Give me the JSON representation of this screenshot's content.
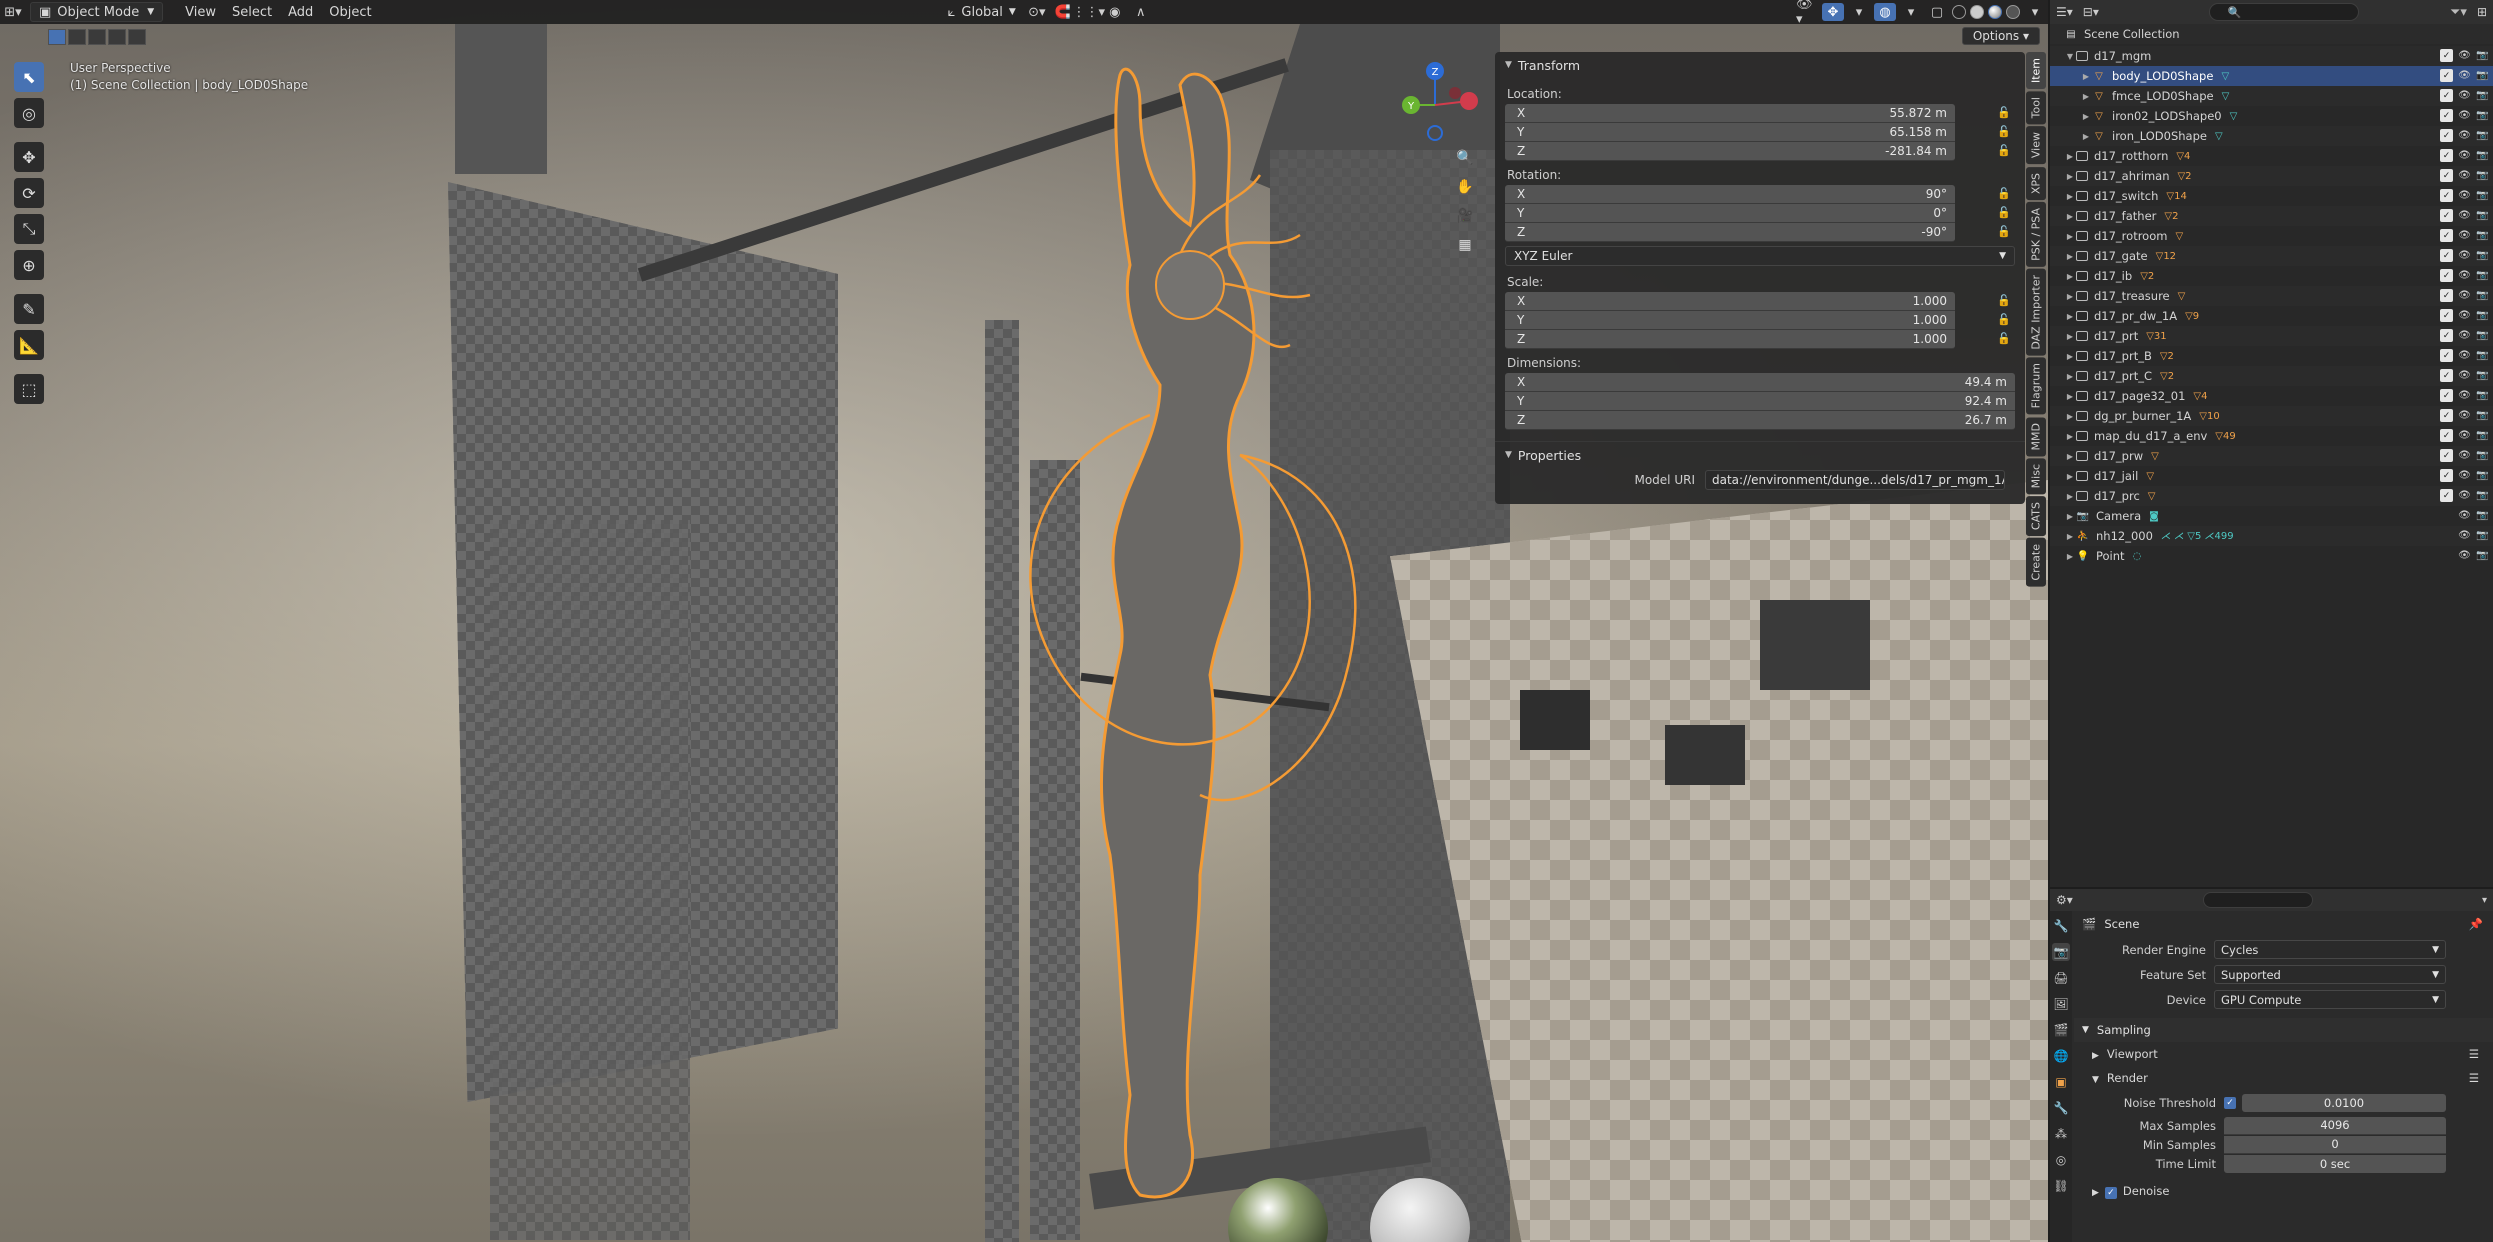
{
  "header": {
    "mode": "Object Mode",
    "menus": [
      "View",
      "Select",
      "Add",
      "Object"
    ],
    "orientation": "Global",
    "options": "Options"
  },
  "viewport": {
    "line1": "User Perspective",
    "line2": "(1) Scene Collection | body_LOD0Shape",
    "gizmo": {
      "x": "X",
      "y": "Y",
      "z": "Z"
    }
  },
  "npanel": {
    "transform_title": "Transform",
    "location_label": "Location:",
    "location": {
      "x": "55.872 m",
      "y": "65.158 m",
      "z": "-281.84 m"
    },
    "rotation_label": "Rotation:",
    "rotation": {
      "x": "90°",
      "y": "0°",
      "z": "-90°"
    },
    "rotation_mode": "XYZ Euler",
    "scale_label": "Scale:",
    "scale": {
      "x": "1.000",
      "y": "1.000",
      "z": "1.000"
    },
    "dimensions_label": "Dimensions:",
    "dimensions": {
      "x": "49.4 m",
      "y": "92.4 m",
      "z": "26.7 m"
    },
    "axis": {
      "x": "X",
      "y": "Y",
      "z": "Z"
    },
    "properties_title": "Properties",
    "model_uri_label": "Model URI",
    "model_uri_value": "data://environment/dunge...dels/d17_pr_mgm_1A.gmdl"
  },
  "vtabs": [
    "Item",
    "Tool",
    "View",
    "XPS",
    "PSK / PSA",
    "DAZ Importer",
    "Flagrum",
    "MMD",
    "Misc",
    "CATS",
    "Create"
  ],
  "outliner": {
    "root": "Scene Collection",
    "rows": [
      {
        "name": "d17_mgm",
        "depth": 1,
        "icon": "coll",
        "expanded": true,
        "extra": ""
      },
      {
        "name": "body_LOD0Shape",
        "depth": 2,
        "icon": "mesh",
        "sel": true,
        "extra": "▽"
      },
      {
        "name": "fmce_LOD0Shape",
        "depth": 2,
        "icon": "mesh",
        "extra": "▽"
      },
      {
        "name": "iron02_LODShape0",
        "depth": 2,
        "icon": "mesh",
        "extra": "▽"
      },
      {
        "name": "iron_LOD0Shape",
        "depth": 2,
        "icon": "mesh",
        "extra": "▽"
      },
      {
        "name": "d17_rotthorn",
        "depth": 1,
        "icon": "coll",
        "extra": "▽4"
      },
      {
        "name": "d17_ahriman",
        "depth": 1,
        "icon": "coll",
        "extra": "▽2"
      },
      {
        "name": "d17_switch",
        "depth": 1,
        "icon": "coll",
        "extra": "▽14"
      },
      {
        "name": "d17_father",
        "depth": 1,
        "icon": "coll",
        "extra": "▽2"
      },
      {
        "name": "d17_rotroom",
        "depth": 1,
        "icon": "coll",
        "extra": "▽"
      },
      {
        "name": "d17_gate",
        "depth": 1,
        "icon": "coll",
        "extra": "▽12"
      },
      {
        "name": "d17_ib",
        "depth": 1,
        "icon": "coll",
        "extra": "▽2"
      },
      {
        "name": "d17_treasure",
        "depth": 1,
        "icon": "coll",
        "extra": "▽"
      },
      {
        "name": "d17_pr_dw_1A",
        "depth": 1,
        "icon": "coll",
        "extra": "▽9"
      },
      {
        "name": "d17_prt",
        "depth": 1,
        "icon": "coll",
        "extra": "▽31"
      },
      {
        "name": "d17_prt_B",
        "depth": 1,
        "icon": "coll",
        "extra": "▽2"
      },
      {
        "name": "d17_prt_C",
        "depth": 1,
        "icon": "coll",
        "extra": "▽2"
      },
      {
        "name": "d17_page32_01",
        "depth": 1,
        "icon": "coll",
        "extra": "▽4"
      },
      {
        "name": "dg_pr_burner_1A",
        "depth": 1,
        "icon": "coll",
        "extra": "▽10"
      },
      {
        "name": "map_du_d17_a_env",
        "depth": 1,
        "icon": "coll",
        "extra": "▽49"
      },
      {
        "name": "d17_prw",
        "depth": 1,
        "icon": "coll",
        "extra": "▽"
      },
      {
        "name": "d17_jail",
        "depth": 1,
        "icon": "coll",
        "extra": "▽"
      },
      {
        "name": "d17_prc",
        "depth": 1,
        "icon": "coll",
        "extra": "▽"
      },
      {
        "name": "Camera",
        "depth": 1,
        "icon": "cam",
        "extra": "◙",
        "nochk": true
      },
      {
        "name": "nh12_000",
        "depth": 1,
        "icon": "arm",
        "extra": "⋌ ⋌ ▽5 ⋌499",
        "nochk": true
      },
      {
        "name": "Point",
        "depth": 1,
        "icon": "light",
        "extra": "◌",
        "nochk": true
      }
    ]
  },
  "props": {
    "title": "Scene",
    "render_engine_label": "Render Engine",
    "render_engine": "Cycles",
    "feature_set_label": "Feature Set",
    "feature_set": "Supported",
    "device_label": "Device",
    "device": "GPU Compute",
    "sampling": "Sampling",
    "viewport": "Viewport",
    "render": "Render",
    "noise_threshold_label": "Noise Threshold",
    "noise_threshold": "0.0100",
    "max_samples_label": "Max Samples",
    "max_samples": "4096",
    "min_samples_label": "Min Samples",
    "min_samples": "0",
    "time_limit_label": "Time Limit",
    "time_limit": "0 sec",
    "denoise": "Denoise"
  }
}
